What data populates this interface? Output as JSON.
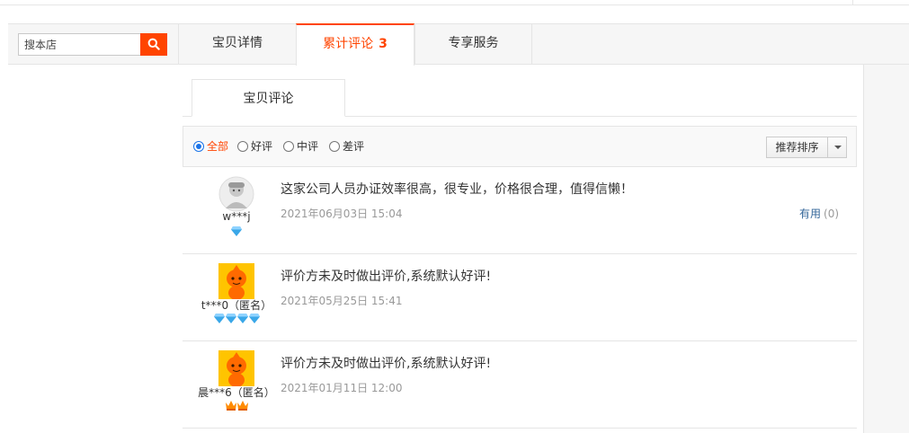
{
  "search": {
    "placeholder": "搜本店"
  },
  "tabs": [
    {
      "label": "宝贝详情"
    },
    {
      "label": "累计评论",
      "count": "3"
    },
    {
      "label": "专享服务"
    }
  ],
  "subtab": {
    "label": "宝贝评论"
  },
  "filter": {
    "options": [
      "全部",
      "好评",
      "中评",
      "差评"
    ],
    "selected": "全部",
    "sort_label": "推荐排序"
  },
  "reviews": [
    {
      "user": "w***j",
      "text": "这家公司人员办证效率很高，很专业，价格很合理，值得信懒！",
      "date": "2021年06月03日 15:04",
      "useful_label": "有用",
      "useful_count": "(0)",
      "badge": "diamond",
      "badge_count": 1,
      "avatar": "grey-person"
    },
    {
      "user": "t***0（匿名）",
      "text": "评价方未及时做出评价,系统默认好评!",
      "date": "2021年05月25日 15:41",
      "badge": "diamond",
      "badge_count": 4,
      "avatar": "orange-mascot"
    },
    {
      "user": "晨***6（匿名）",
      "text": "评价方未及时做出评价,系统默认好评!",
      "date": "2021年01月11日 12:00",
      "badge": "crown",
      "badge_count": 2,
      "avatar": "orange-mascot"
    }
  ]
}
